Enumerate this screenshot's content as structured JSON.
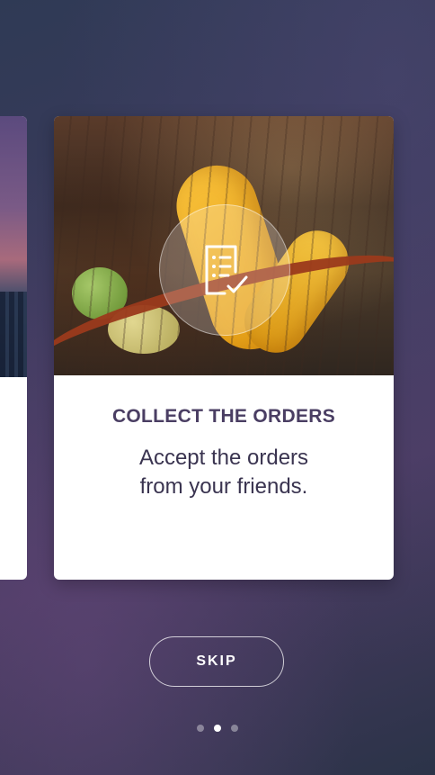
{
  "card": {
    "title": "COLLECT THE ORDERS",
    "description_line1": "Accept the orders",
    "description_line2": "from your friends.",
    "icon": "order-checklist-icon"
  },
  "skip_label": "SKIP",
  "pagination": {
    "total": 3,
    "active_index": 1
  },
  "colors": {
    "title_text": "#4a3e63",
    "body_text": "#3a3450",
    "skip_border": "#ffffff"
  }
}
